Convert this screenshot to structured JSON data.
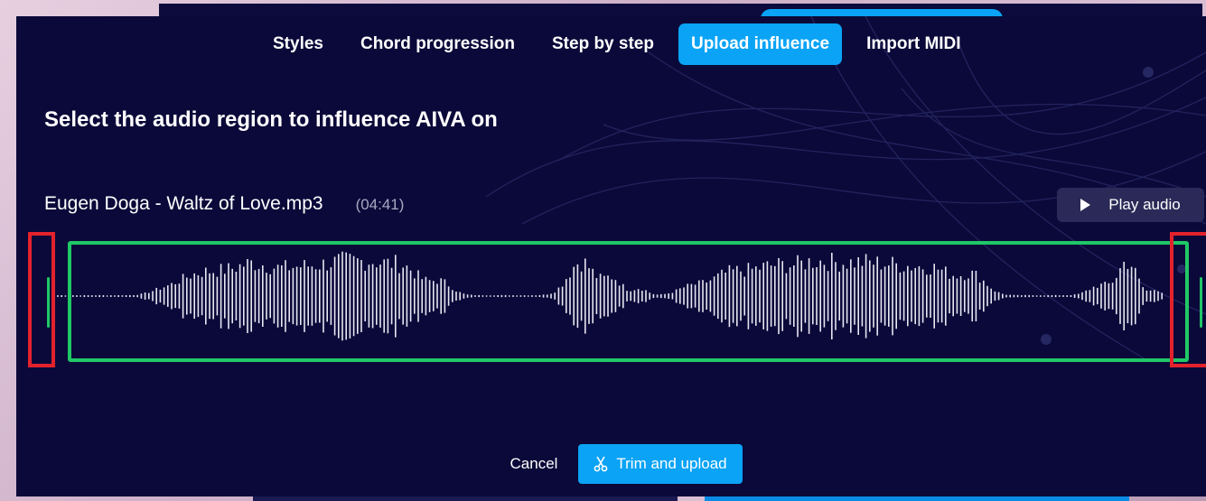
{
  "tabs": [
    {
      "label": "Styles",
      "active": false
    },
    {
      "label": "Chord progression",
      "active": false
    },
    {
      "label": "Step by step",
      "active": false
    },
    {
      "label": "Upload influence",
      "active": true
    },
    {
      "label": "Import MIDI",
      "active": false
    }
  ],
  "heading": "Select the audio region to influence AIVA on",
  "file": {
    "name": "Eugen Doga - Waltz of Love.mp3",
    "duration": "(04:41)"
  },
  "play_button": {
    "label": "Play audio",
    "icon": "play-icon"
  },
  "actions": {
    "cancel_label": "Cancel",
    "trim_label": "Trim and upload",
    "trim_icon": "scissors-icon"
  },
  "colors": {
    "accent": "#0aa3f5",
    "selection": "#20c766",
    "handle_highlight": "#e4222d",
    "modal_bg": "#0b0939"
  }
}
